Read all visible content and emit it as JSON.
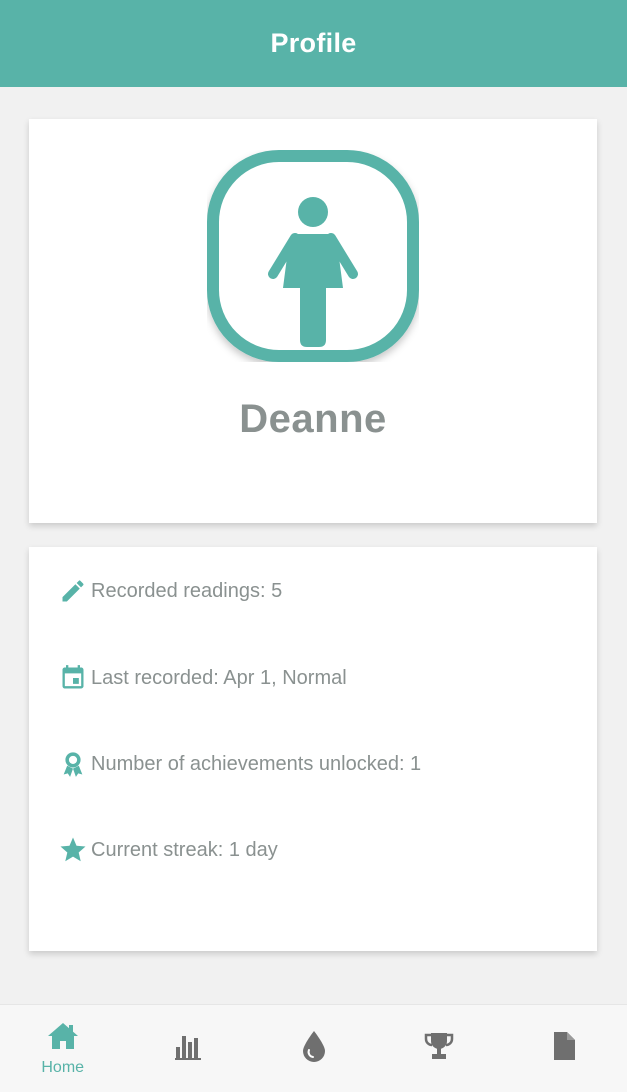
{
  "header": {
    "title": "Profile"
  },
  "profile": {
    "name": "Deanne",
    "avatar_icon": "female-person-icon"
  },
  "stats": [
    {
      "icon": "pencil-icon",
      "text": "Recorded readings: 5"
    },
    {
      "icon": "calendar-icon",
      "text": "Last recorded: Apr 1, Normal"
    },
    {
      "icon": "award-ribbon-icon",
      "text": "Number of achievements unlocked: 1"
    },
    {
      "icon": "star-icon",
      "text": "Current streak: 1 day"
    }
  ],
  "nav": {
    "items": [
      {
        "icon": "home-icon",
        "label": "Home",
        "active": true
      },
      {
        "icon": "bar-chart-icon",
        "label": "",
        "active": false
      },
      {
        "icon": "water-drop-icon",
        "label": "",
        "active": false
      },
      {
        "icon": "trophy-icon",
        "label": "",
        "active": false
      },
      {
        "icon": "document-icon",
        "label": "",
        "active": false
      }
    ]
  },
  "colors": {
    "accent": "#58b3a8",
    "text_muted": "#8a9190",
    "icon_inactive": "#6f6f6f",
    "background": "#f1f1f1"
  }
}
